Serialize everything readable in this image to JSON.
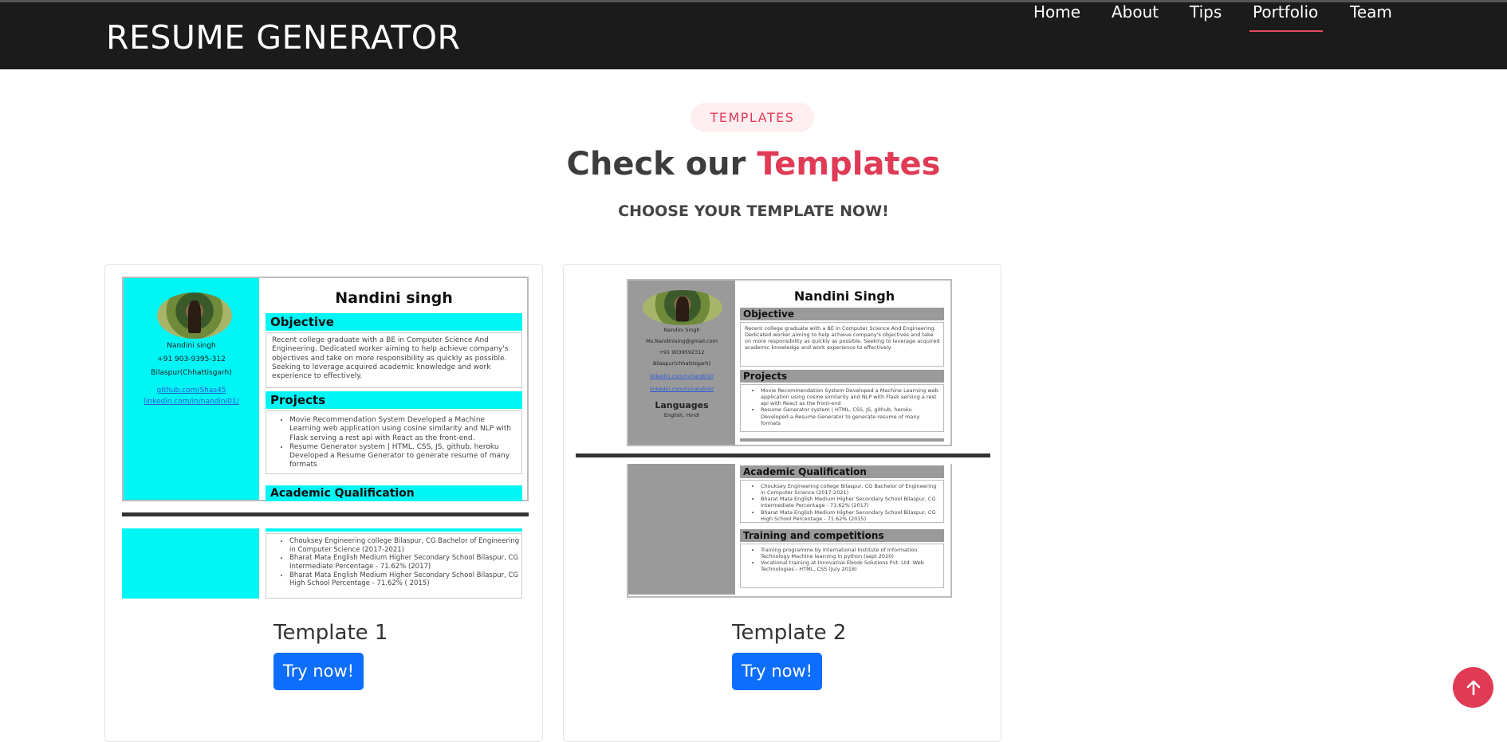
{
  "header": {
    "brand": "RESUME GENERATOR",
    "nav": [
      {
        "label": "Home"
      },
      {
        "label": "About"
      },
      {
        "label": "Tips"
      },
      {
        "label": "Portfolio",
        "active": true
      },
      {
        "label": "Team"
      }
    ]
  },
  "section": {
    "pill": "TEMPLATES",
    "title_prefix": "Check our ",
    "title_accent": "Templates",
    "subtitle": "CHOOSE YOUR TEMPLATE NOW!"
  },
  "templates": [
    {
      "title": "Template 1",
      "button": "Try now!",
      "preview": {
        "name": "Nandini singh",
        "side": [
          "Nandini singh",
          "+91 903-9395-312",
          "Bilaspur(Chhattisgarh)"
        ],
        "links": [
          "github.com/Shas45",
          "linkedin.com/in/nandini01/"
        ],
        "headings": [
          "Objective",
          "Projects",
          "Academic Qualification"
        ],
        "objective": "Recent college graduate with a BE in Computer Science And Engineering. Dedicated worker aiming to help achieve company's objectives and take on more responsibility as quickly as possible. Seeking to leverage acquired academic knowledge and work experience to effectively.",
        "projects": [
          "Movie Recommendation System Developed a Machine Learning web application using cosine similarity and NLP with Flask serving a rest api with React as the front-end.",
          "Resume Generator system | HTML, CSS, JS, github, heroku Developed a Resume Generator to generate resume of many formats"
        ],
        "academics": [
          "Chouksey Engineering college Bilaspur, CG Bachelor of Engineering in Computer Science (2017-2021)",
          "Bharat Mata English Medium Higher Secondary School Bilaspur, CG Intermediate Percentage - 71.62% (2017)",
          "Bharat Mata English Medium Higher Secondary School Bilaspur, CG High School Percentage - 71.62% ( 2015)"
        ]
      }
    },
    {
      "title": "Template 2",
      "button": "Try now!",
      "preview": {
        "name": "Nandini Singh",
        "side": [
          "Nandini Singh",
          "Ms.Nandinising@gmail.com",
          "+91 9039592312",
          "Bilaspur(chhattisgarh)"
        ],
        "links": [
          "linkedin.com/in/nandini0",
          "linkedin.com/in/nandini0"
        ],
        "languages_heading": "Languages",
        "languages": "English, Hindi",
        "headings": [
          "Objective",
          "Projects",
          "Academic Qualification",
          "Training and competitions"
        ],
        "objective": "Recent college graduate with a BE in Computer Science And Engineering. Dedicated worker aiming to help achieve company's objectives and take on more responsibility as quickly as possible. Seeking to leverage acquired academic knowledge and work experience to effectively.",
        "projects": [
          "Movie Recommendation System Developed a Machine Learning web application using cosine similarity and NLP with Flask serving a rest api with React as the front-end",
          "Resume Generator system | HTML, CSS, JS, github, heroku Developed a Resume Generator to generate resume of many formats"
        ],
        "academics": [
          "Chouksey Engineering college Bilaspur, CG Bachelor of Engineering in Computer Science (2017-2021)",
          "Bharat Mata English Medium Higher Secondary School Bilaspur, CG Intermediate Percentage - 71.62% (2017)",
          "Bharat Mata English Medium Higher Secondary School Bilaspur, CG High School Percentage - 71.62% (2015)"
        ],
        "training": [
          "Training programme by International Institute of Information Technology Machine learning in python (sept 2020)",
          "Vocational training at Innovative Ebook Solutions Pvt. Ltd. Web Technologies - HTML, CSS (July 2018)"
        ]
      }
    }
  ],
  "colors": {
    "accent": "#e03a55",
    "primary_button": "#0d6efd",
    "header_bg": "#1b1b1b",
    "template1_sidebar": "#00f5f5",
    "template2_sidebar": "#9a9a9a"
  },
  "icons": {
    "scroll_top": "arrow-up-icon"
  }
}
